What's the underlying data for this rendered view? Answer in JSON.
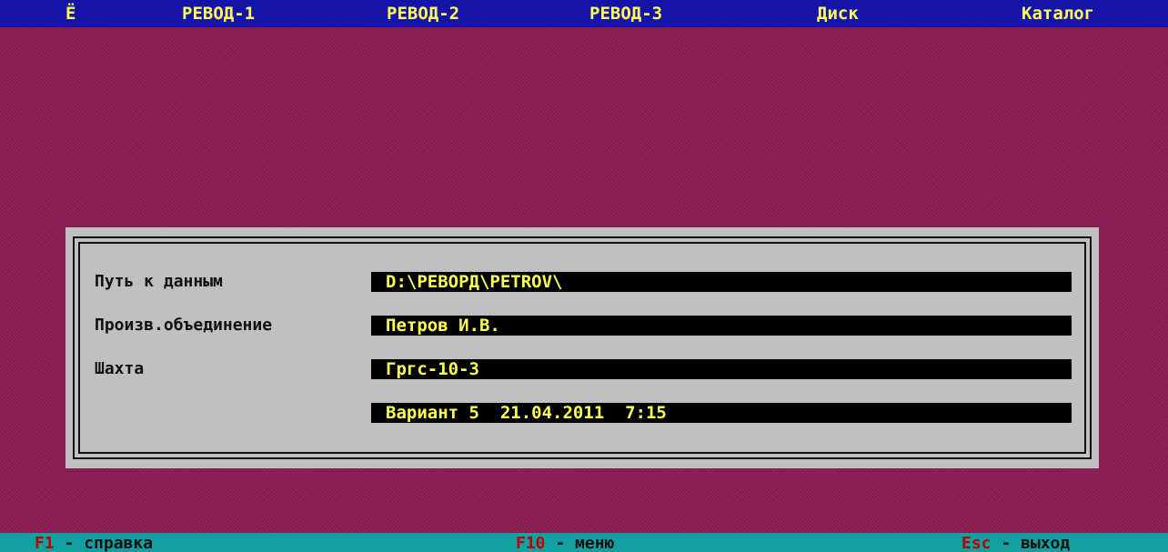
{
  "menu": {
    "items": [
      {
        "label": "Ё"
      },
      {
        "label": "РЕВОД-1"
      },
      {
        "label": "РЕВОД-2"
      },
      {
        "label": "РЕВОД-3"
      },
      {
        "label": "Диск"
      },
      {
        "label": "Каталог"
      }
    ]
  },
  "dialog": {
    "fields": [
      {
        "label": "Путь к данным",
        "value": "D:\\РЕВОРД\\PETROV\\"
      },
      {
        "label": "Произв.объединение",
        "value": "Петров И.В."
      },
      {
        "label": "Шахта",
        "value": "Гргс-10-3"
      },
      {
        "label": "",
        "value": "Вариант 5  21.04.2011  7:15"
      }
    ]
  },
  "status": {
    "hints": [
      {
        "key": "F1",
        "sep": " - ",
        "desc": "справка"
      },
      {
        "key": "F10",
        "sep": " - ",
        "desc": "меню"
      },
      {
        "key": "Esc",
        "sep": " - ",
        "desc": "выход"
      }
    ]
  },
  "colors": {
    "desktop": "#8a1d52",
    "menubar_bg": "#1414a8",
    "menu_text": "#ffff55",
    "dialog_bg": "#c0c0c0",
    "field_bg": "#000000",
    "field_text": "#ffff55",
    "statusbar_bg": "#12a0a0",
    "hotkey_text": "#b80000"
  }
}
